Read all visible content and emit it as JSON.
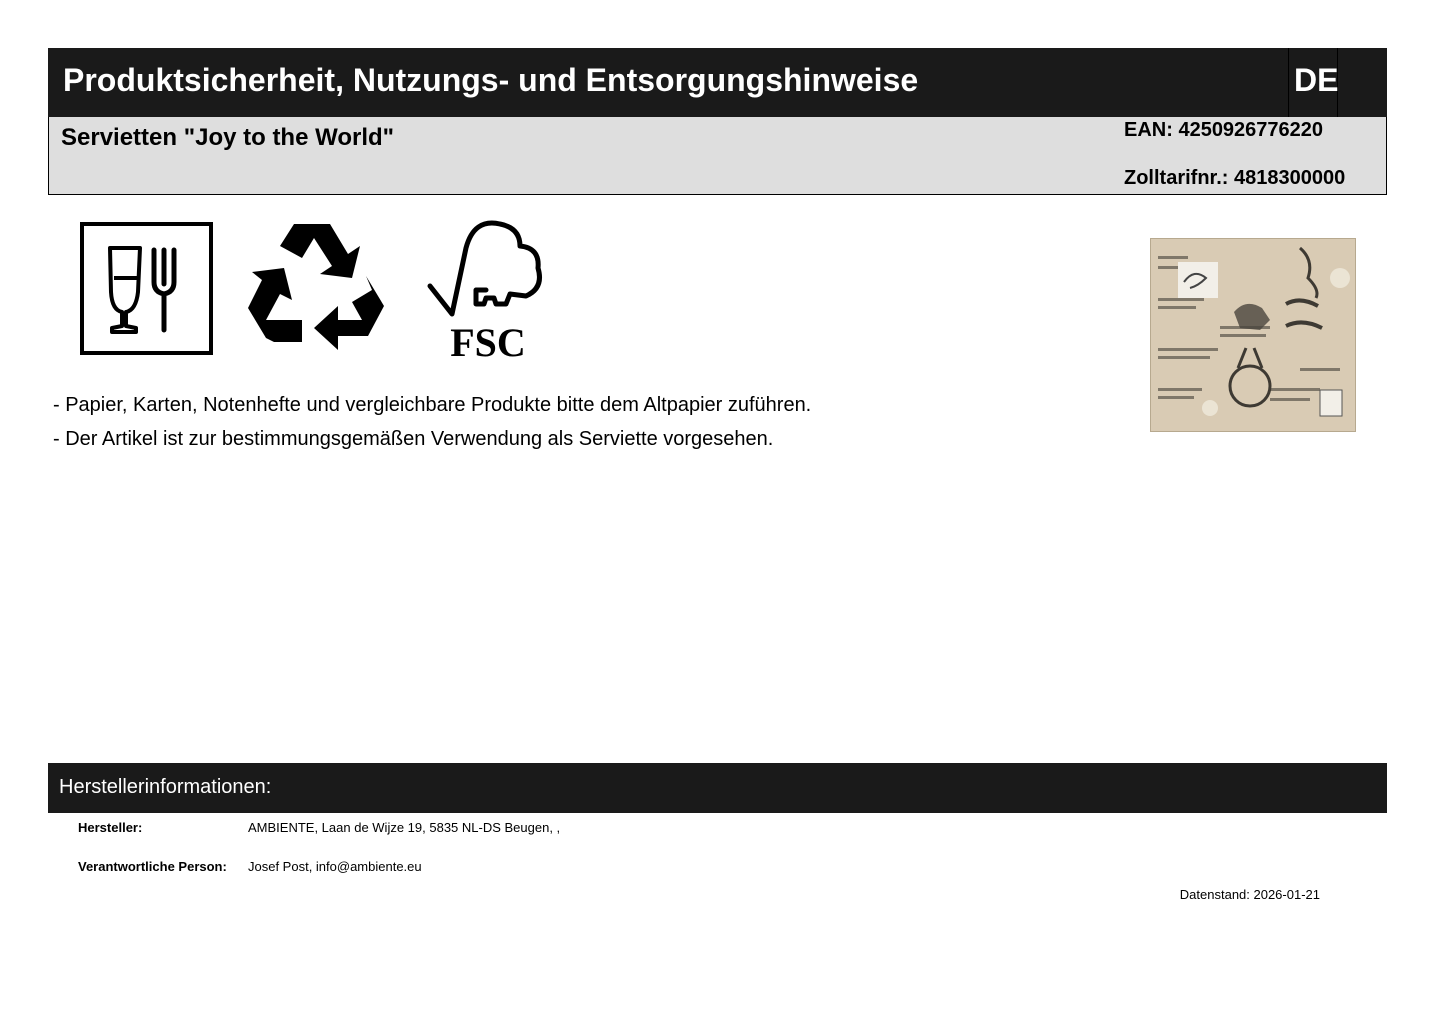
{
  "header": {
    "title": "Produktsicherheit, Nutzungs- und Entsorgungshinweise",
    "language": "DE"
  },
  "product": {
    "name": "Servietten \"Joy to the World\"",
    "ean": "EAN: 4250926776220",
    "customs": "Zolltarifnr.: 4818300000"
  },
  "symbols": {
    "food_safe": "food-safe-icon",
    "recycling": "recycling-icon",
    "fsc": "fsc-logo",
    "fsc_text": "FSC"
  },
  "hints": [
    "- Papier, Karten, Notenhefte und vergleichbare Produkte bitte dem Altpapier zuführen.",
    "- Der Artikel ist zur bestimmungsgemäßen Verwendung als Serviette vorgesehen."
  ],
  "manufacturer": {
    "section_title": "Herstellerinformationen:",
    "manufacturer_label": "Hersteller:",
    "manufacturer_value": "AMBIENTE, Laan de Wijze 19, 5835 NL-DS Beugen, ,",
    "responsible_label": "Verantwortliche Person:",
    "responsible_value": "Josef Post, info@ambiente.eu"
  },
  "footer": {
    "date": "Datenstand: 2026-01-21"
  },
  "colors": {
    "header_bg": "#1a1a1a",
    "subheader_bg": "#dedede"
  }
}
